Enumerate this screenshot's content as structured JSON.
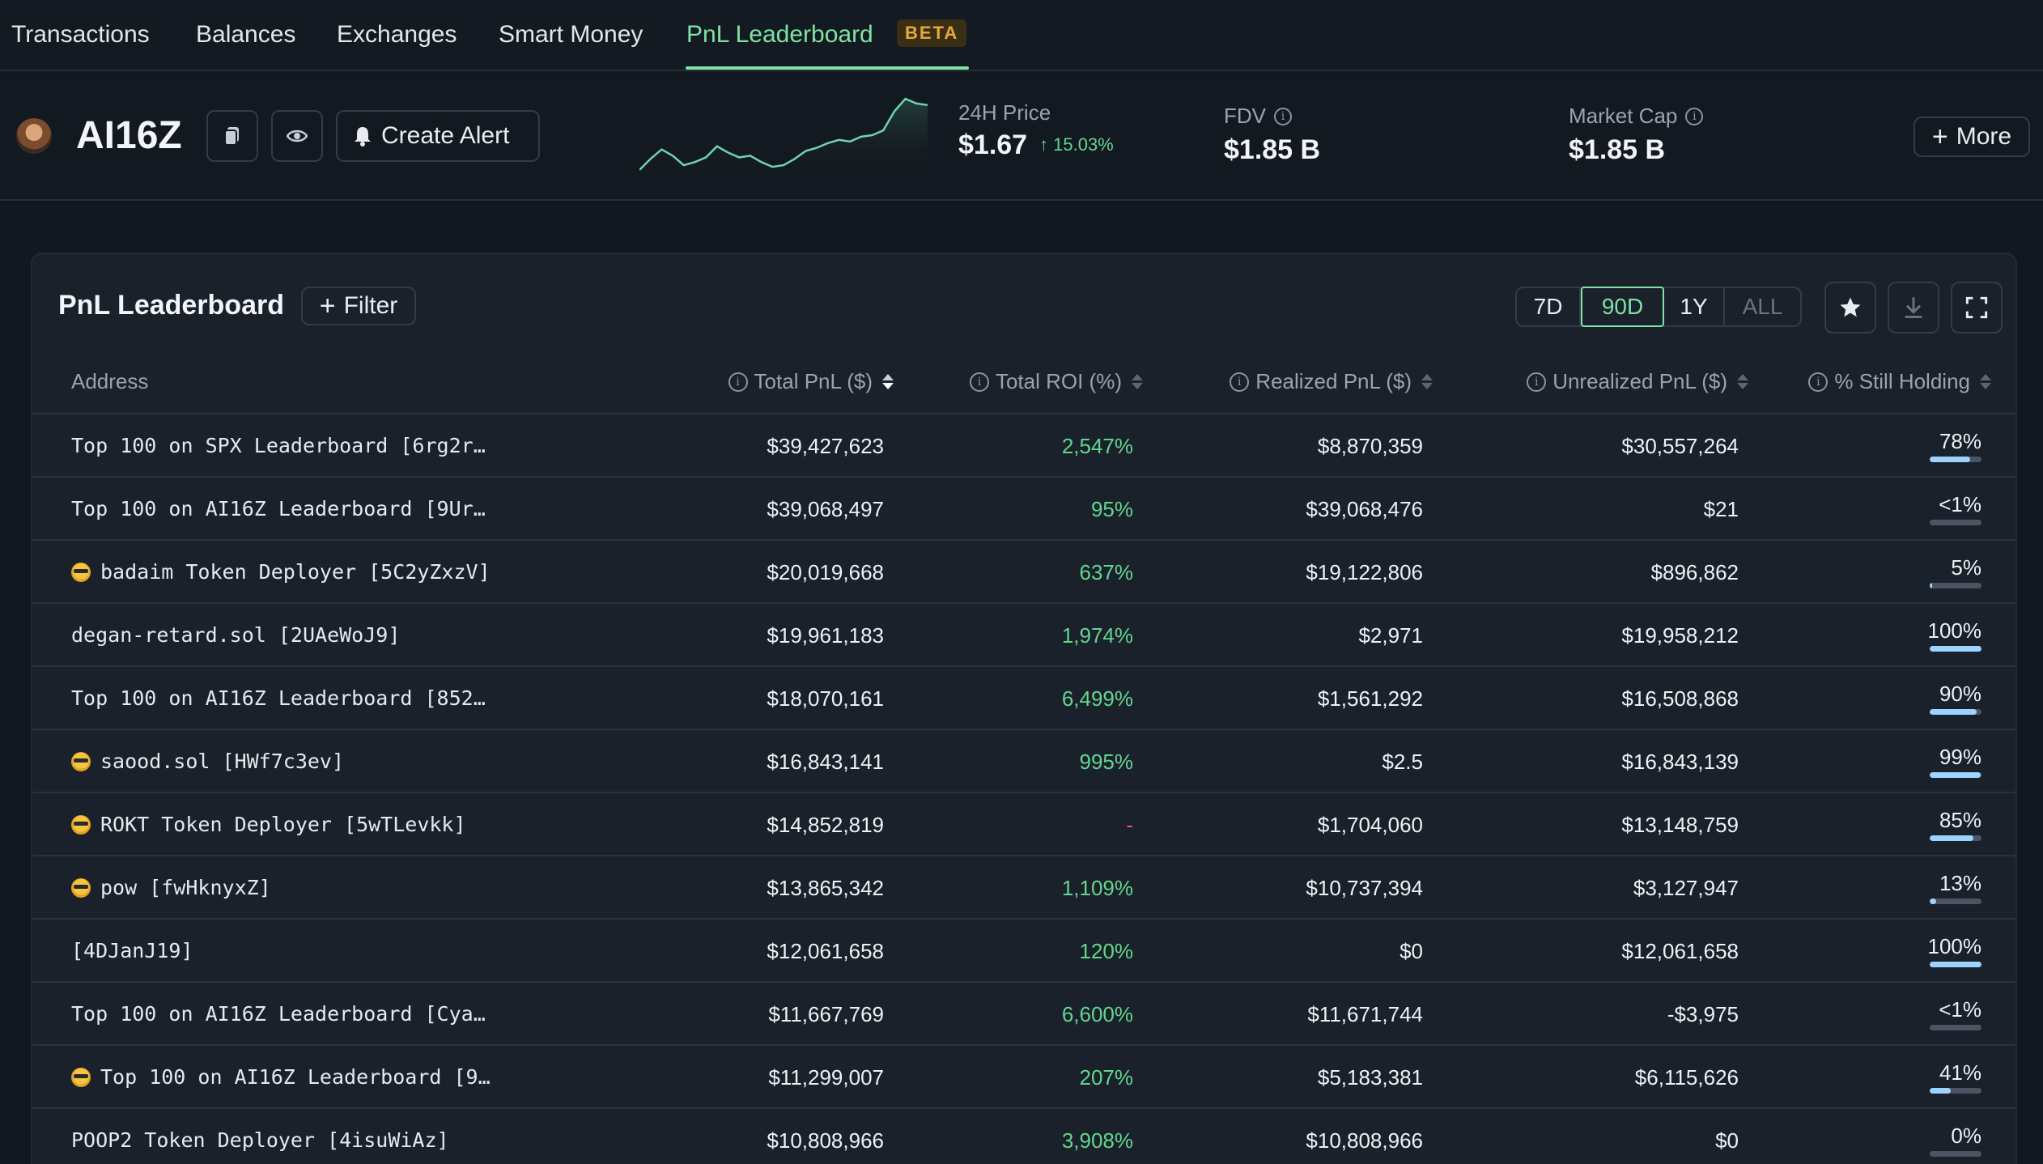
{
  "nav": {
    "tabs": [
      {
        "label": "Transactions"
      },
      {
        "label": "Balances"
      },
      {
        "label": "Exchanges"
      },
      {
        "label": "Smart Money"
      },
      {
        "label": "PnL Leaderboard",
        "badge": "BETA",
        "active": true
      }
    ]
  },
  "token": {
    "name": "AI16Z",
    "create_alert_label": "Create Alert",
    "price_label": "24H Price",
    "price": "$1.67",
    "price_change": "15.03%",
    "fdv_label": "FDV",
    "fdv": "$1.85 B",
    "mcap_label": "Market Cap",
    "mcap": "$1.85 B",
    "more_label": "More"
  },
  "sparkline": [
    55,
    62,
    68,
    64,
    58,
    60,
    63,
    70,
    66,
    63,
    64,
    60,
    57,
    58,
    62,
    67,
    69,
    72,
    74,
    73,
    76,
    77,
    80,
    92,
    100,
    97,
    96
  ],
  "panel": {
    "title": "PnL Leaderboard",
    "filter_label": "Filter",
    "ranges": [
      "7D",
      "90D",
      "1Y",
      "ALL"
    ],
    "active_range": "90D"
  },
  "table": {
    "headers": {
      "address": "Address",
      "total_pnl": "Total PnL ($)",
      "total_roi": "Total ROI (%)",
      "realized": "Realized PnL ($)",
      "unrealized": "Unrealized PnL ($)",
      "holding": "% Still Holding"
    },
    "rows": [
      {
        "address": "Top 100 on SPX Leaderboard [6rg2r…",
        "emoji": false,
        "pnl": "$39,427,623",
        "roi": "2,547%",
        "realized": "$8,870,359",
        "unrealized": "$30,557,264",
        "holding": "78%",
        "hold_frac": 0.78
      },
      {
        "address": "Top 100 on AI16Z Leaderboard [9Ur…",
        "emoji": false,
        "pnl": "$39,068,497",
        "roi": "95%",
        "realized": "$39,068,476",
        "unrealized": "$21",
        "holding": "<1%",
        "hold_frac": 0.0
      },
      {
        "address": "badaim Token Deployer [5C2yZxzV]",
        "emoji": true,
        "pnl": "$20,019,668",
        "roi": "637%",
        "realized": "$19,122,806",
        "unrealized": "$896,862",
        "holding": "5%",
        "hold_frac": 0.05
      },
      {
        "address": "degan-retard.sol [2UAeWoJ9]",
        "emoji": false,
        "pnl": "$19,961,183",
        "roi": "1,974%",
        "realized": "$2,971",
        "unrealized": "$19,958,212",
        "holding": "100%",
        "hold_frac": 1.0
      },
      {
        "address": "Top 100 on AI16Z Leaderboard [852…",
        "emoji": false,
        "pnl": "$18,070,161",
        "roi": "6,499%",
        "realized": "$1,561,292",
        "unrealized": "$16,508,868",
        "holding": "90%",
        "hold_frac": 0.9
      },
      {
        "address": "saood.sol [HWf7c3ev]",
        "emoji": true,
        "pnl": "$16,843,141",
        "roi": "995%",
        "realized": "$2.5",
        "unrealized": "$16,843,139",
        "holding": "99%",
        "hold_frac": 0.99
      },
      {
        "address": "ROKT Token Deployer [5wTLevkk]",
        "emoji": true,
        "pnl": "$14,852,819",
        "roi": "-",
        "roi_neg": true,
        "realized": "$1,704,060",
        "unrealized": "$13,148,759",
        "holding": "85%",
        "hold_frac": 0.85
      },
      {
        "address": "pow [fwHknyxZ]",
        "emoji": true,
        "pnl": "$13,865,342",
        "roi": "1,109%",
        "realized": "$10,737,394",
        "unrealized": "$3,127,947",
        "holding": "13%",
        "hold_frac": 0.13
      },
      {
        "address": "[4DJanJ19]",
        "emoji": false,
        "pnl": "$12,061,658",
        "roi": "120%",
        "realized": "$0",
        "unrealized": "$12,061,658",
        "holding": "100%",
        "hold_frac": 1.0
      },
      {
        "address": "Top 100 on AI16Z Leaderboard [Cya…",
        "emoji": false,
        "pnl": "$11,667,769",
        "roi": "6,600%",
        "realized": "$11,671,744",
        "unrealized": "-$3,975",
        "holding": "<1%",
        "hold_frac": 0.0
      },
      {
        "address": "Top 100 on AI16Z Leaderboard [9…",
        "emoji": true,
        "pnl": "$11,299,007",
        "roi": "207%",
        "realized": "$5,183,381",
        "unrealized": "$6,115,626",
        "holding": "41%",
        "hold_frac": 0.41
      },
      {
        "address": "POOP2 Token Deployer [4isuWiAz]",
        "emoji": false,
        "pnl": "$10,808,966",
        "roi": "3,908%",
        "realized": "$10,808,966",
        "unrealized": "$0",
        "holding": "0%",
        "hold_frac": 0.0
      }
    ]
  },
  "colors": {
    "accent": "#7ee3a4",
    "positive": "#62d78f",
    "negative": "#e55b5b",
    "beta": "#e5a83b",
    "hold_bar": "#9fd3ff"
  }
}
